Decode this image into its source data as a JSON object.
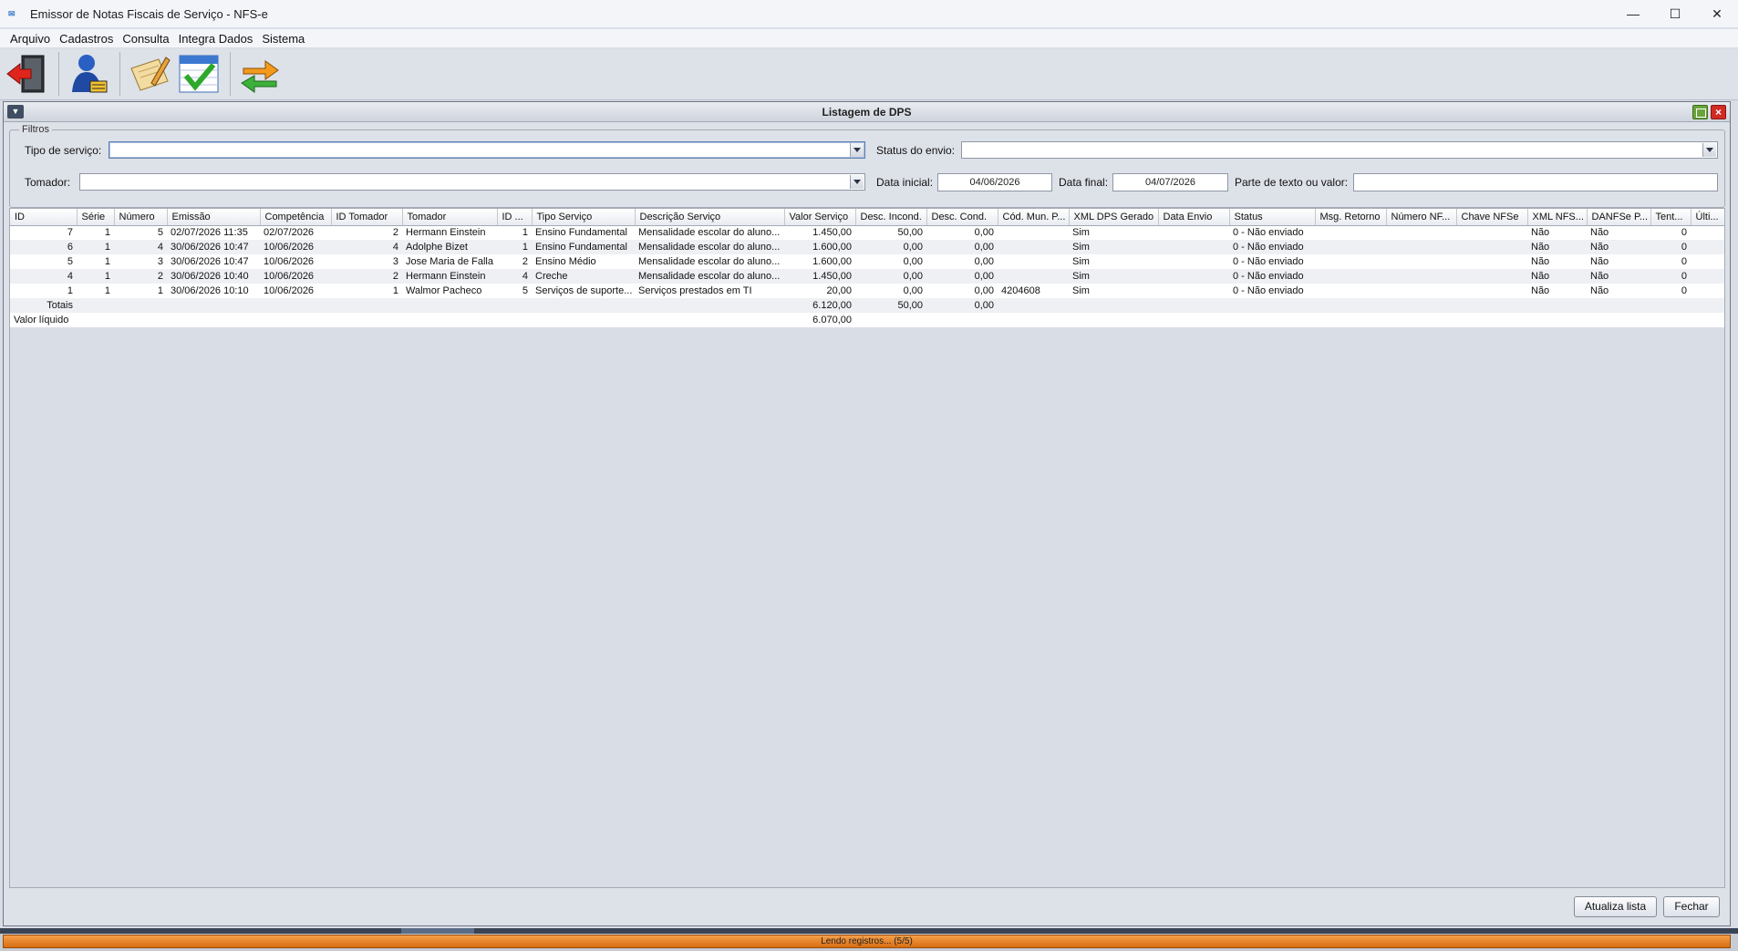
{
  "window": {
    "title": "Emissor de Notas Fiscais de Serviço - NFS-e",
    "minimize_glyph": "—",
    "maximize_glyph": "☐",
    "close_glyph": "✕"
  },
  "menu": [
    "Arquivo",
    "Cadastros",
    "Consulta",
    "Integra Dados",
    "Sistema"
  ],
  "toolbar": {
    "icons": [
      "exit-door-icon",
      "user-register-icon",
      "edit-notes-icon",
      "calendar-check-icon",
      "sync-arrows-icon"
    ]
  },
  "frame": {
    "title": "Listagem de DPS"
  },
  "filters": {
    "legend": "Filtros",
    "tipo_servico_label": "Tipo de serviço:",
    "tipo_servico_value": "",
    "status_envio_label": "Status do envio:",
    "status_envio_value": "",
    "tomador_label": "Tomador:",
    "tomador_value": "",
    "data_inicial_label": "Data inicial:",
    "data_inicial_value": "04/06/2026",
    "data_final_label": "Data final:",
    "data_final_value": "04/07/2026",
    "texto_label": "Parte de texto ou valor:",
    "texto_value": ""
  },
  "table": {
    "columns": [
      "ID",
      "Série",
      "Número",
      "Emissão",
      "Competência",
      "ID Tomador",
      "Tomador",
      "ID ...",
      "Tipo Serviço",
      "Descrição Serviço",
      "Valor Serviço",
      "Desc. Incond.",
      "Desc. Cond.",
      "Cód. Mun. P...",
      "XML DPS Gerado",
      "Data Envio",
      "Status",
      "Msg. Retorno",
      "Número NF...",
      "Chave NFSe",
      "XML NFS...",
      "DANFSe P...",
      "Tent...",
      "Últi..."
    ],
    "rows": [
      [
        "7",
        "1",
        "5",
        "02/07/2026 11:35",
        "02/07/2026",
        "2",
        "Hermann Einstein",
        "1",
        "Ensino Fundamental",
        "Mensalidade escolar do aluno...",
        "1.450,00",
        "50,00",
        "0,00",
        "",
        "Sim",
        "",
        "0 - Não enviado",
        "",
        "",
        "",
        "Não",
        "Não",
        "0",
        ""
      ],
      [
        "6",
        "1",
        "4",
        "30/06/2026 10:47",
        "10/06/2026",
        "4",
        "Adolphe Bizet",
        "1",
        "Ensino Fundamental",
        "Mensalidade escolar do aluno...",
        "1.600,00",
        "0,00",
        "0,00",
        "",
        "Sim",
        "",
        "0 - Não enviado",
        "",
        "",
        "",
        "Não",
        "Não",
        "0",
        ""
      ],
      [
        "5",
        "1",
        "3",
        "30/06/2026 10:47",
        "10/06/2026",
        "3",
        "Jose Maria de Falla",
        "2",
        "Ensino Médio",
        "Mensalidade escolar do aluno...",
        "1.600,00",
        "0,00",
        "0,00",
        "",
        "Sim",
        "",
        "0 - Não enviado",
        "",
        "",
        "",
        "Não",
        "Não",
        "0",
        ""
      ],
      [
        "4",
        "1",
        "2",
        "30/06/2026 10:40",
        "10/06/2026",
        "2",
        "Hermann Einstein",
        "4",
        "Creche",
        "Mensalidade escolar do aluno...",
        "1.450,00",
        "0,00",
        "0,00",
        "",
        "Sim",
        "",
        "0 - Não enviado",
        "",
        "",
        "",
        "Não",
        "Não",
        "0",
        ""
      ],
      [
        "1",
        "1",
        "1",
        "30/06/2026 10:10",
        "10/06/2026",
        "1",
        "Walmor Pacheco",
        "5",
        "Serviços de suporte...",
        "Serviços prestados em TI",
        "20,00",
        "0,00",
        "0,00",
        "4204608",
        "Sim",
        "",
        "0 - Não enviado",
        "",
        "",
        "",
        "Não",
        "Não",
        "0",
        ""
      ]
    ],
    "totals": {
      "label": "Totais",
      "valor_servico": "6.120,00",
      "desc_incond": "50,00",
      "desc_cond": "0,00"
    },
    "liquido": {
      "label": "Valor líquido",
      "valor": "6.070,00"
    }
  },
  "buttons": {
    "atualiza": "Atualiza lista",
    "fechar": "Fechar"
  },
  "status": {
    "text": "Lendo registros... (5/5)",
    "progress": 1.0
  }
}
